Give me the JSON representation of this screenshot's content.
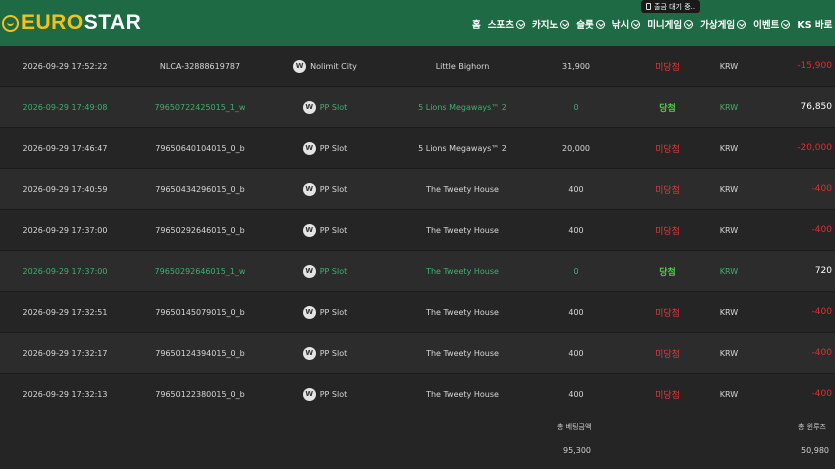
{
  "header": {
    "logo_euro": "EURO",
    "logo_star": "STAR",
    "nav": [
      {
        "label": "홈",
        "chevron": false
      },
      {
        "label": "스포츠",
        "chevron": true
      },
      {
        "label": "카지노",
        "chevron": true
      },
      {
        "label": "슬롯",
        "chevron": true
      },
      {
        "label": "낚시",
        "chevron": true
      },
      {
        "label": "미니게임",
        "chevron": true
      },
      {
        "label": "가상게임",
        "chevron": true
      },
      {
        "label": "이벤트",
        "chevron": true
      },
      {
        "label": "KS 바로",
        "chevron": false
      }
    ],
    "tooltip": "출금 대기 중.."
  },
  "rows": [
    {
      "date": "2026-09-29 17:52:22",
      "id": "NLCA-32888619787",
      "provider": "Nolimit City",
      "game": "Little Bighorn",
      "bet": "31,900",
      "status": "미당첨",
      "currency": "KRW",
      "amount": "-15,900",
      "win": false
    },
    {
      "date": "2026-09-29 17:49:08",
      "id": "79650722425015_1_w",
      "provider": "PP Slot",
      "game": "5 Lions Megaways™ 2",
      "bet": "0",
      "status": "당첨",
      "currency": "KRW",
      "amount": "76,850",
      "win": true
    },
    {
      "date": "2026-09-29 17:46:47",
      "id": "79650640104015_0_b",
      "provider": "PP Slot",
      "game": "5 Lions Megaways™ 2",
      "bet": "20,000",
      "status": "미당첨",
      "currency": "KRW",
      "amount": "-20,000",
      "win": false
    },
    {
      "date": "2026-09-29 17:40:59",
      "id": "79650434296015_0_b",
      "provider": "PP Slot",
      "game": "The Tweety House",
      "bet": "400",
      "status": "미당첨",
      "currency": "KRW",
      "amount": "-400",
      "win": false
    },
    {
      "date": "2026-09-29 17:37:00",
      "id": "79650292646015_0_b",
      "provider": "PP Slot",
      "game": "The Tweety House",
      "bet": "400",
      "status": "미당첨",
      "currency": "KRW",
      "amount": "-400",
      "win": false
    },
    {
      "date": "2026-09-29 17:37:00",
      "id": "79650292646015_1_w",
      "provider": "PP Slot",
      "game": "The Tweety House",
      "bet": "0",
      "status": "당첨",
      "currency": "KRW",
      "amount": "720",
      "win": true
    },
    {
      "date": "2026-09-29 17:32:51",
      "id": "79650145079015_0_b",
      "provider": "PP Slot",
      "game": "The Tweety House",
      "bet": "400",
      "status": "미당첨",
      "currency": "KRW",
      "amount": "-400",
      "win": false
    },
    {
      "date": "2026-09-29 17:32:17",
      "id": "79650124394015_0_b",
      "provider": "PP Slot",
      "game": "The Tweety House",
      "bet": "400",
      "status": "미당첨",
      "currency": "KRW",
      "amount": "-400",
      "win": false
    },
    {
      "date": "2026-09-29 17:32:13",
      "id": "79650122380015_0_b",
      "provider": "PP Slot",
      "game": "The Tweety House",
      "bet": "400",
      "status": "미당첨",
      "currency": "KRW",
      "amount": "-400",
      "win": false
    }
  ],
  "summary": {
    "bet_label": "총 베팅금액",
    "bet_value": "95,300",
    "win_label": "총 윈루즈",
    "win_value": "50,980"
  },
  "colors": {
    "header_bg": "#1e6a44",
    "logo_yellow": "#f2c21b",
    "lose_red": "#e03a3a",
    "win_green": "#4cd14c",
    "win_row_text": "#3fb06f"
  },
  "icons": {
    "provider": "provider-logo-icon",
    "nav_chevron": "chevron-down-circle-icon",
    "tooltip": "phone-icon"
  }
}
